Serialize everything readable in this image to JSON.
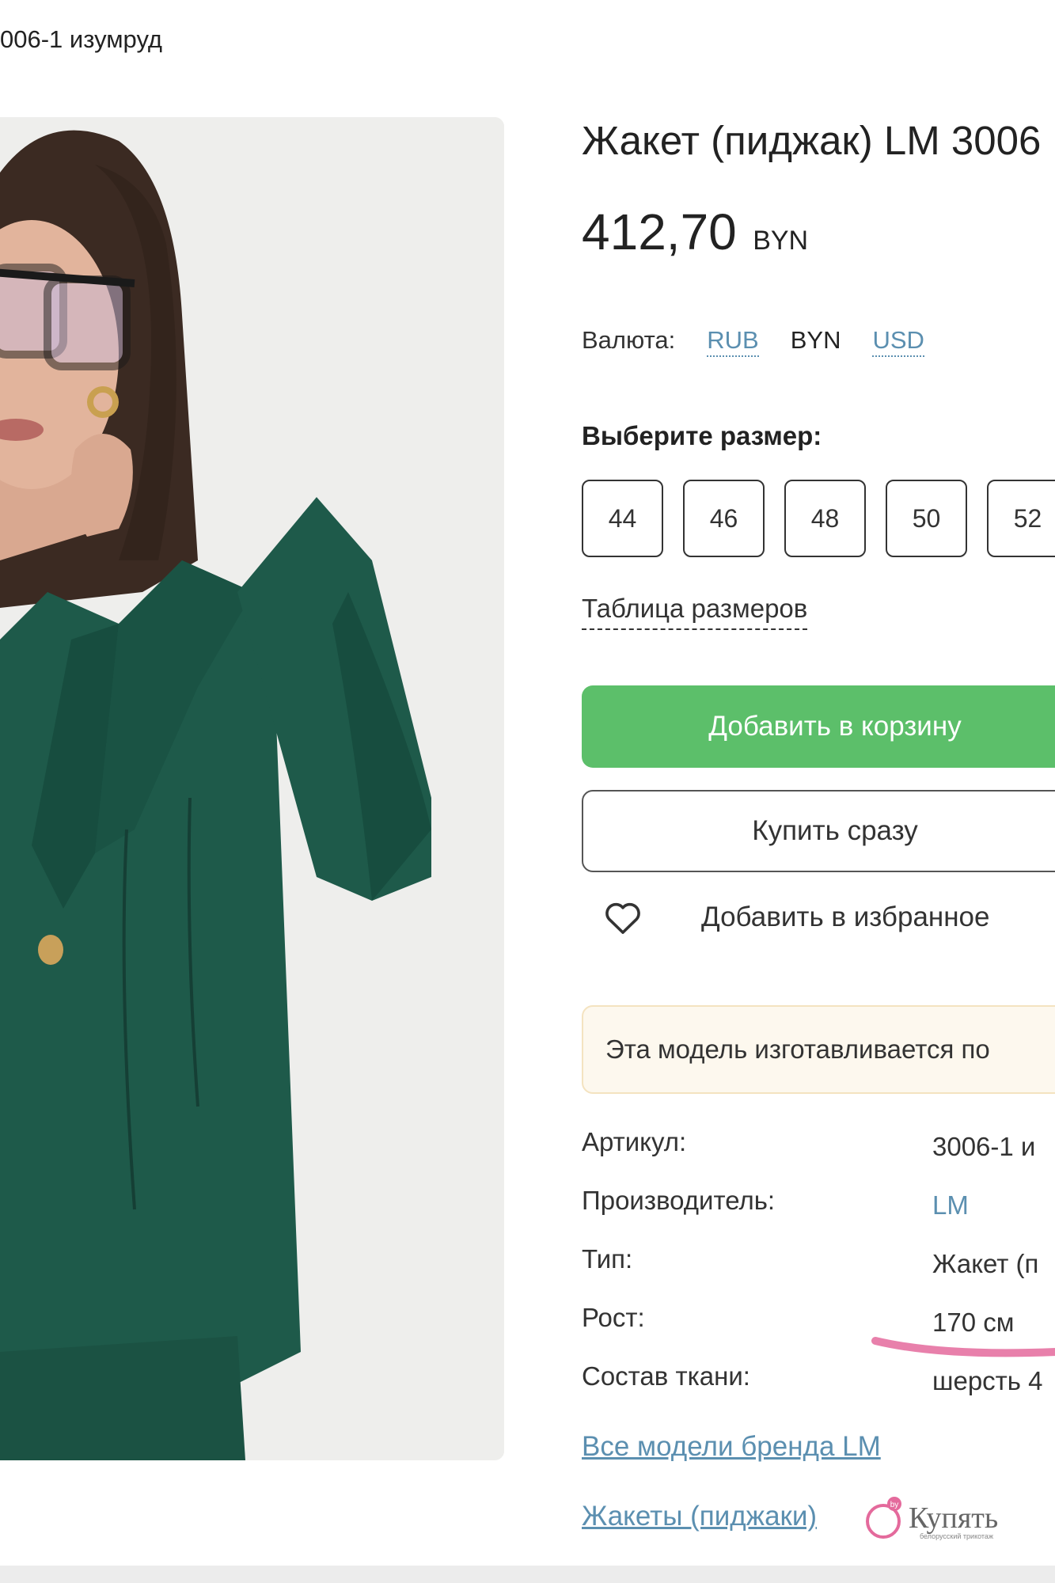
{
  "breadcrumb": {
    "current": "006-1 изумруд"
  },
  "product": {
    "title": "Жакет (пиджак) LM 3006",
    "price": "412,70",
    "price_currency": "BYN"
  },
  "currency": {
    "label": "Валюта:",
    "options": [
      {
        "code": "RUB",
        "state": "link"
      },
      {
        "code": "BYN",
        "state": "active"
      },
      {
        "code": "USD",
        "state": "link"
      }
    ]
  },
  "sizes": {
    "heading": "Выберите размер:",
    "options": [
      "44",
      "46",
      "48",
      "50",
      "52"
    ],
    "table_link": "Таблица размеров"
  },
  "actions": {
    "add_to_cart": "Добавить в корзину",
    "buy_now": "Купить сразу",
    "add_to_favorites": "Добавить в избранное"
  },
  "notice": {
    "text": "Эта модель изготавливается по"
  },
  "specs": [
    {
      "label": "Артикул:",
      "value": "3006-1 и"
    },
    {
      "label": "Производитель:",
      "value": "LM"
    },
    {
      "label": "Тип:",
      "value": "Жакет (п"
    },
    {
      "label": "Рост:",
      "value": "170 см"
    },
    {
      "label": "Состав ткани:",
      "value": "шерсть 4"
    }
  ],
  "links": {
    "brand_models": "Все модели бренда LM",
    "category": "Жакеты (пиджаки)"
  },
  "watermark": {
    "word": "Купять",
    "badge": "by",
    "subtitle": "белорусский трикотаж"
  },
  "colors": {
    "accent_green": "#5cbf6a",
    "link_blue": "#5b8fb0",
    "jacket_green": "#1e5a4a",
    "notice_bg": "#fdf8ee"
  },
  "icons": [
    "heart-icon",
    "logo-mark-icon"
  ]
}
